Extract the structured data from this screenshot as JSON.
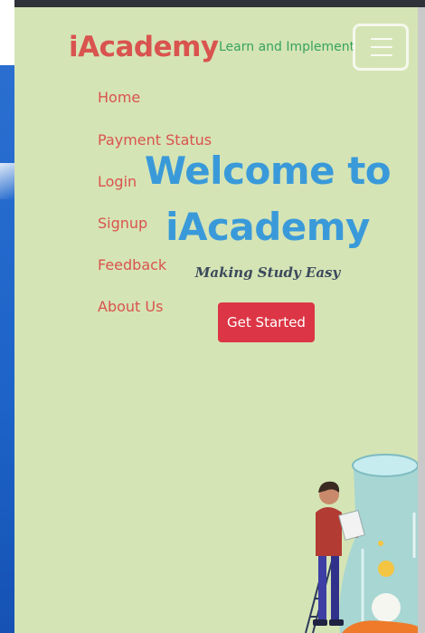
{
  "header": {
    "brand": "iAcademy",
    "tagline": "Learn and Implement",
    "menu_toggle_icon": "hamburger-icon"
  },
  "nav": {
    "items": [
      {
        "label": "Home"
      },
      {
        "label": "Payment Status"
      },
      {
        "label": "Login"
      },
      {
        "label": "Signup"
      },
      {
        "label": "Feedback"
      },
      {
        "label": "About Us"
      }
    ]
  },
  "hero": {
    "title_line1": "Welcome to",
    "title_line2": "iAcademy",
    "subtitle": "Making Study Easy",
    "cta_label": "Get Started"
  },
  "colors": {
    "background": "#d5e4b5",
    "brand": "#d9534f",
    "tagline": "#36a35c",
    "hero_title": "#3a9ad9",
    "cta": "#dc3545"
  }
}
